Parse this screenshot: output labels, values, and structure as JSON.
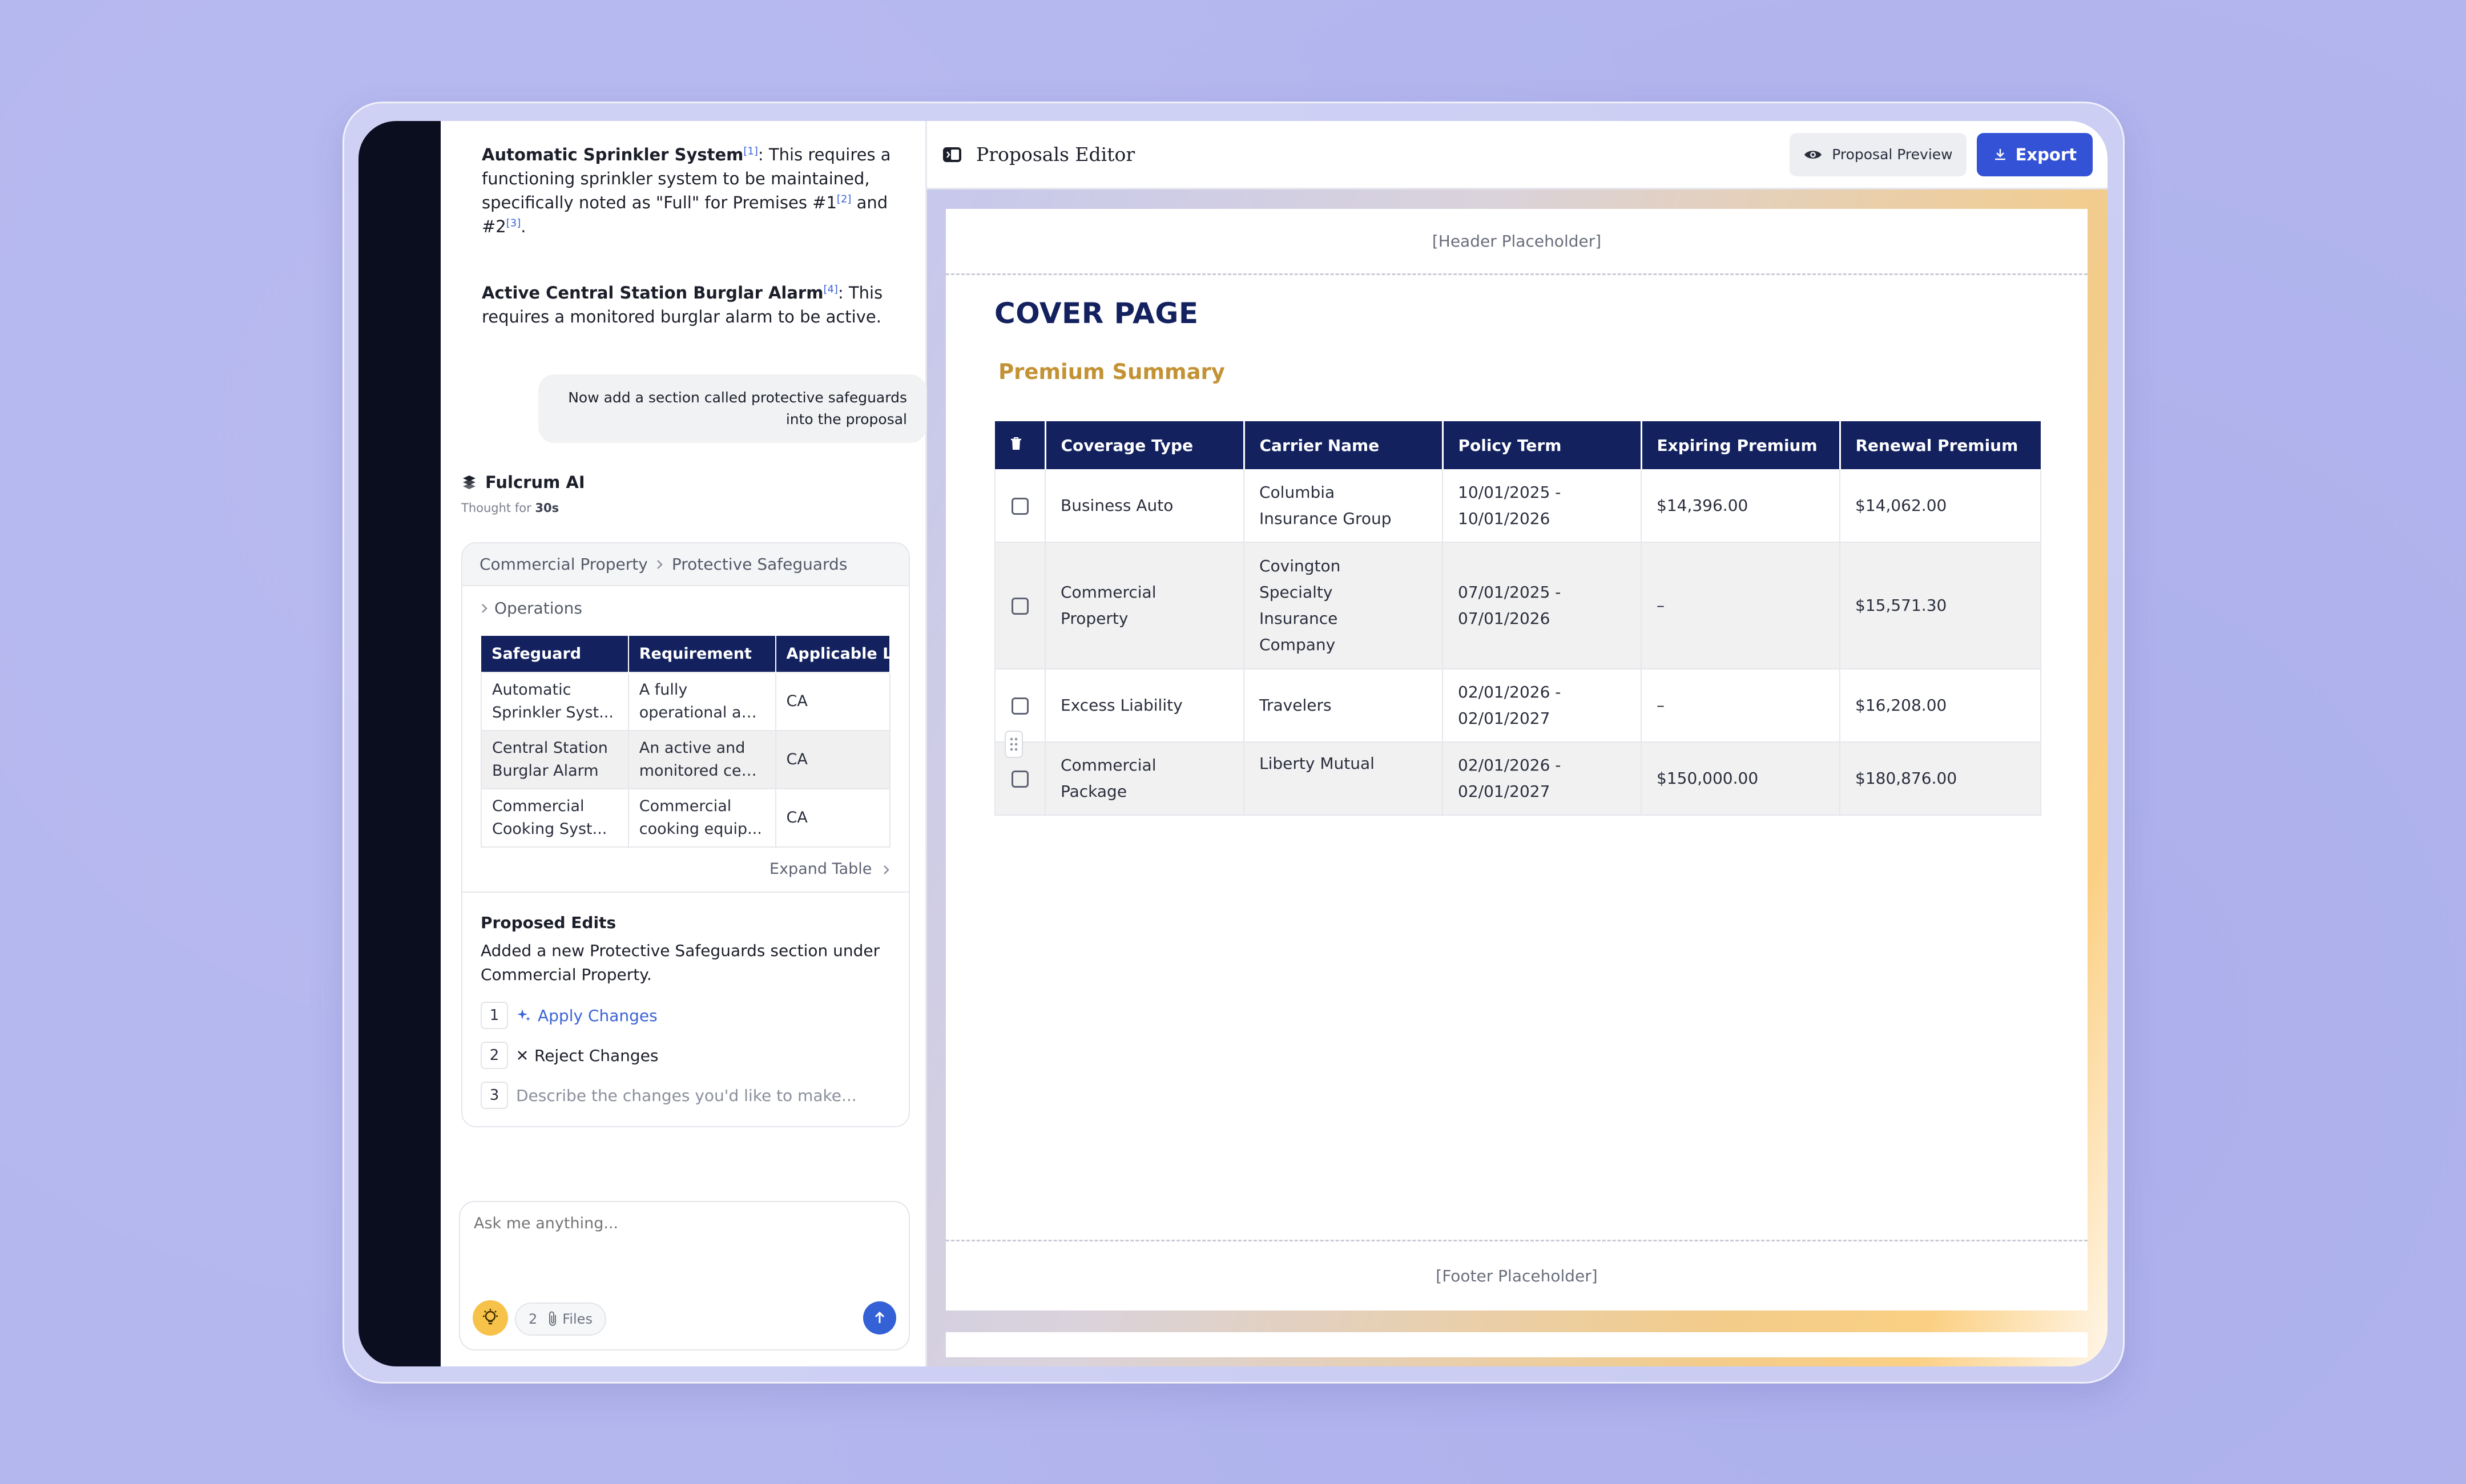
{
  "chat": {
    "p1": {
      "bold": "Automatic Sprinkler System",
      "ref1": "[1]",
      "text1": ": This requires a functioning sprinkler system to be maintained, specifically noted as \"Full\" for Premises #1",
      "ref2": "[2]",
      "text2": " and #2",
      "ref3": "[3]",
      "text3": "."
    },
    "p2": {
      "bold": "Active Central Station Burglar Alarm",
      "ref": "[4]",
      "text": ": This requires a monitored burglar alarm to be active."
    },
    "user_message": "Now add a section called protective safeguards into the proposal",
    "assistant_name": "Fulcrum AI",
    "thought_label": "Thought",
    "thought_for": "for",
    "thought_duration": "30s",
    "breadcrumb": [
      "Commercial Property",
      "Protective Safeguards"
    ],
    "section": "Operations",
    "table": {
      "headers": [
        "Safeguard",
        "Requirement",
        "Applicable L..."
      ],
      "rows": [
        {
          "safeguard": "Automatic Sprinkler Syst...",
          "safeguard_l1": "Automatic",
          "safeguard_l2": "Sprinkler Syst...",
          "req_l1": "A fully",
          "req_l2": "operational au...",
          "loc": "CA"
        },
        {
          "safeguard": "Central Station Burglar Alarm",
          "safeguard_l1": "Central Station",
          "safeguard_l2": "Burglar Alarm",
          "req_l1": "An active and",
          "req_l2": "monitored cen...",
          "loc": "CA"
        },
        {
          "safeguard": "Commercial Cooking Syst...",
          "safeguard_l1": "Commercial",
          "safeguard_l2": "Cooking Syst...",
          "req_l1": "Commercial",
          "req_l2": "cooking equip...",
          "loc": "CA"
        }
      ]
    },
    "expand_label": "Expand Table",
    "proposed": {
      "title": "Proposed Edits",
      "description": "Added a new Protective Safeguards section under Commercial Property.",
      "options": [
        {
          "num": "1",
          "label": "Apply Changes"
        },
        {
          "num": "2",
          "label": "Reject Changes"
        },
        {
          "num": "3",
          "label": "Describe the changes you'd like to make..."
        }
      ]
    },
    "composer": {
      "placeholder": "Ask me anything...",
      "files_count": "2",
      "files_label": "Files"
    }
  },
  "editor": {
    "title": "Proposals Editor",
    "preview_label": "Proposal Preview",
    "export_label": "Export",
    "doc": {
      "header": "[Header Placeholder]",
      "footer": "[Footer Placeholder]",
      "cover_title": "COVER PAGE",
      "section_title": "Premium Summary",
      "columns": [
        "Coverage Type",
        "Carrier Name",
        "Policy Term",
        "Expiring Premium",
        "Renewal Premium"
      ],
      "rows": [
        {
          "coverage_l1": "Business Auto",
          "coverage_l2": "",
          "carrier_l1": "Columbia",
          "carrier_l2": "Insurance Group",
          "carrier_l3": "",
          "carrier_l4": "",
          "term_l1": "10/01/2025 -",
          "term_l2": "10/01/2026",
          "expiring": "$14,396.00",
          "renewal": "$14,062.00"
        },
        {
          "coverage_l1": "Commercial",
          "coverage_l2": "Property",
          "carrier_l1": "Covington",
          "carrier_l2": "Specialty",
          "carrier_l3": "Insurance",
          "carrier_l4": "Company",
          "term_l1": "07/01/2025 -",
          "term_l2": "07/01/2026",
          "expiring": "–",
          "renewal": "$15,571.30"
        },
        {
          "coverage_l1": "Excess Liability",
          "coverage_l2": "",
          "carrier_l1": "Travelers",
          "carrier_l2": "",
          "carrier_l3": "",
          "carrier_l4": "",
          "term_l1": "02/01/2026 -",
          "term_l2": "02/01/2027",
          "expiring": "–",
          "renewal": "$16,208.00"
        },
        {
          "coverage_l1": "Commercial",
          "coverage_l2": "Package",
          "carrier_l1": "Liberty Mutual",
          "carrier_l2": "",
          "carrier_l3": "",
          "carrier_l4": "",
          "term_l1": "02/01/2026 -",
          "term_l2": "02/01/2027",
          "expiring": "$150,000.00",
          "renewal": "$180,876.00"
        }
      ]
    }
  },
  "colors": {
    "navy": "#13215f",
    "accent_blue": "#3352d6",
    "gold": "#c39235",
    "background": "#b3b6ee"
  }
}
